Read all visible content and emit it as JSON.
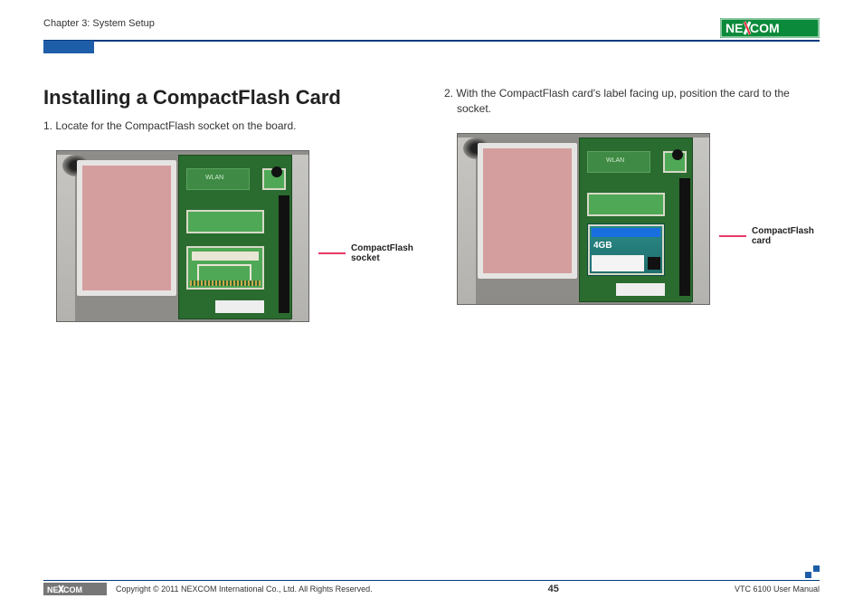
{
  "header": {
    "chapter": "Chapter 3: System Setup",
    "brand": "NEXCOM"
  },
  "main": {
    "title": "Installing a CompactFlash Card",
    "steps": [
      "1.  Locate for the CompactFlash socket on the board.",
      "2.  With the CompactFlash card's label facing up, position the card to the socket."
    ],
    "callouts": {
      "socket": "CompactFlash\nsocket",
      "card": "CompactFlash\ncard"
    },
    "cf_card_capacity": "4GB"
  },
  "footer": {
    "brand": "NEXCOM",
    "copyright": "Copyright © 2011 NEXCOM International Co., Ltd. All Rights Reserved.",
    "page_number": "45",
    "manual": "VTC 6100 User Manual"
  }
}
